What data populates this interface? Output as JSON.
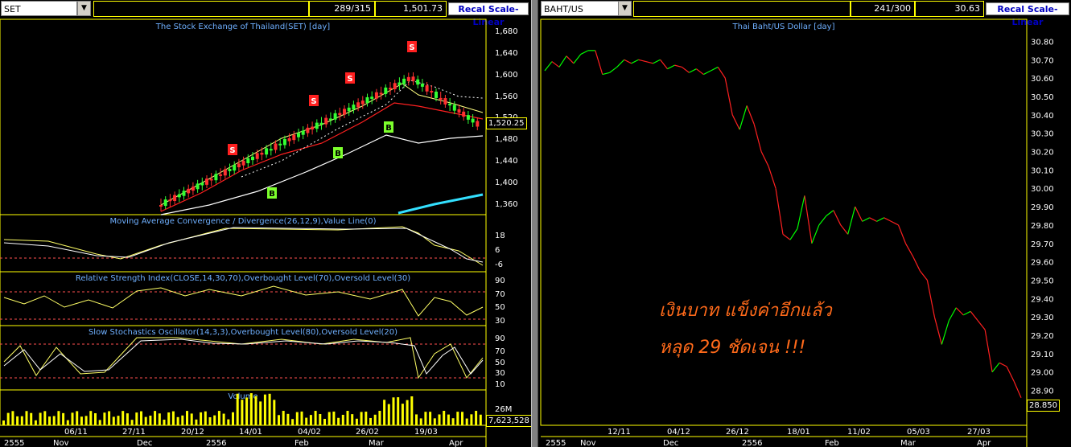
{
  "left": {
    "symbol": "SET",
    "counter": "289/315",
    "last_value": "1,501.73",
    "recal_label": "Recal Scale-Linear",
    "main_title": "The Stock Exchange of Thailand(SET) [day]",
    "current_price_tag": "1,520.25",
    "y_ticks": [
      "1,680",
      "1,640",
      "1,600",
      "1,560",
      "1,520",
      "1,480",
      "1,440",
      "1,400",
      "1,360"
    ],
    "macd_title": "Moving Average Convergence / Divergence(26,12,9),Value Line(0)",
    "macd_ticks": [
      "18",
      "6",
      "-6"
    ],
    "rsi_title": "Relative Strength Index(CLOSE,14,30,70),Overbought Level(70),Oversold Level(30)",
    "rsi_ticks": [
      "90",
      "70",
      "50",
      "30"
    ],
    "stoch_title": "Slow Stochastics Oscillator(14,3,3),Overbought Level(80),Oversold Level(20)",
    "stoch_ticks": [
      "90",
      "70",
      "50",
      "30",
      "10"
    ],
    "volume_title": "Volume",
    "volume_tick": "26M",
    "volume_tag": "7,623,528",
    "date_labels_top": [
      "06/11",
      "27/11",
      "20/12",
      "14/01",
      "04/02",
      "26/02",
      "19/03"
    ],
    "date_labels_bottom": [
      "2555",
      "Nov",
      "Dec",
      "2556",
      "Feb",
      "Mar",
      "Apr"
    ],
    "signals": [
      {
        "label": "S",
        "color": "#ff2020"
      },
      {
        "label": "S",
        "color": "#ff2020"
      },
      {
        "label": "S",
        "color": "#ff2020"
      },
      {
        "label": "S",
        "color": "#ff2020"
      },
      {
        "label": "B",
        "color": "#7cff2c"
      },
      {
        "label": "B",
        "color": "#7cff2c"
      },
      {
        "label": "B",
        "color": "#7cff2c"
      }
    ]
  },
  "right": {
    "symbol": "BAHT/US",
    "counter": "241/300",
    "last_value": "30.63",
    "recal_label": "Recal Scale-Linear",
    "main_title": "Thai Baht/US Dollar [day]",
    "current_price_tag": "28.850",
    "y_ticks": [
      "30.80",
      "30.70",
      "30.60",
      "30.50",
      "30.40",
      "30.30",
      "30.20",
      "30.10",
      "30.00",
      "29.90",
      "29.80",
      "29.70",
      "29.60",
      "29.50",
      "29.40",
      "29.30",
      "29.20",
      "29.10",
      "29.00",
      "28.90"
    ],
    "date_labels_top": [
      "12/11",
      "04/12",
      "26/12",
      "18/01",
      "11/02",
      "05/03",
      "27/03"
    ],
    "date_labels_bottom": [
      "2555",
      "Nov",
      "Dec",
      "2556",
      "Feb",
      "Mar",
      "Apr"
    ],
    "annotation_line1": "เงินบาท แข็งค่าอีกแล้ว",
    "annotation_line2": "หลุด 29 ชัดเจน !!!",
    "chart_data": {
      "type": "line",
      "title": "Thai Baht/US Dollar [day]",
      "ylim": [
        28.85,
        30.85
      ],
      "y": [
        30.64,
        30.69,
        30.66,
        30.72,
        30.68,
        30.73,
        30.75,
        30.75,
        30.62,
        30.63,
        30.66,
        30.7,
        30.68,
        30.7,
        30.69,
        30.68,
        30.7,
        30.65,
        30.67,
        30.66,
        30.63,
        30.65,
        30.62,
        30.64,
        30.66,
        30.6,
        30.4,
        30.32,
        30.45,
        30.35,
        30.2,
        30.12,
        30.0,
        29.75,
        29.72,
        29.78,
        29.96,
        29.7,
        29.8,
        29.85,
        29.88,
        29.8,
        29.75,
        29.9,
        29.82,
        29.84,
        29.82,
        29.84,
        29.82,
        29.8,
        29.7,
        29.63,
        29.55,
        29.5,
        29.3,
        29.15,
        29.28,
        29.35,
        29.31,
        29.33,
        29.28,
        29.23,
        29.0,
        29.05,
        29.03,
        28.95,
        28.86
      ],
      "colors": {
        "up": "#00ff00",
        "down": "#ff2020"
      }
    }
  }
}
